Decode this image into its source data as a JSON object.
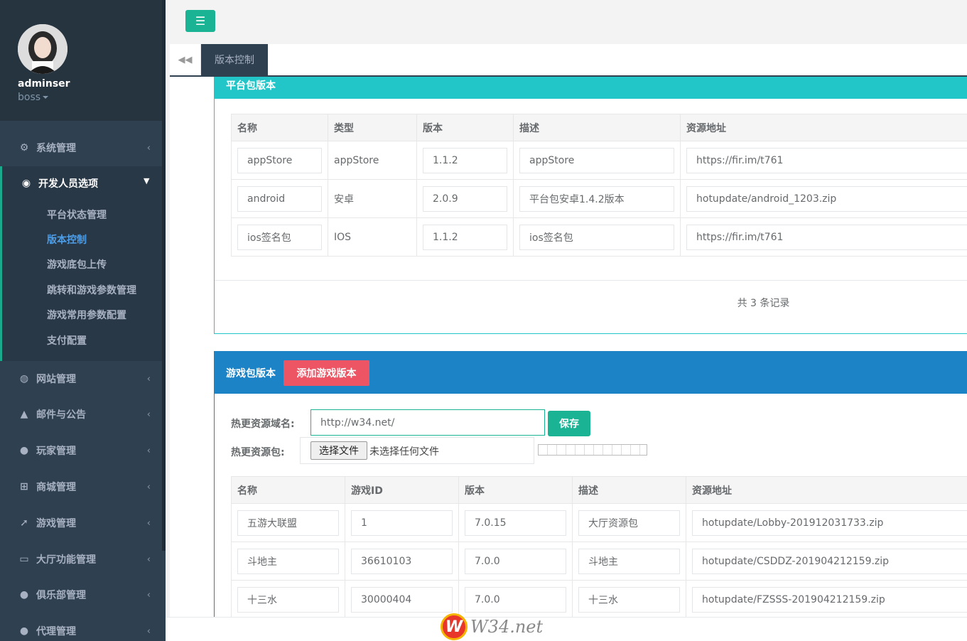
{
  "profile": {
    "name": "adminser",
    "role": "boss"
  },
  "sidebar": {
    "items": [
      {
        "icon": "gears-icon",
        "label": "系统管理"
      },
      {
        "icon": "globe-icon",
        "label": "网站管理"
      },
      {
        "icon": "bell-icon",
        "label": "邮件与公告"
      },
      {
        "icon": "user-icon",
        "label": "玩家管理"
      },
      {
        "icon": "cart-icon",
        "label": "商城管理"
      },
      {
        "icon": "rocket-icon",
        "label": "游戏管理"
      },
      {
        "icon": "desktop-icon",
        "label": "大厅功能管理"
      },
      {
        "icon": "users-icon",
        "label": "俱乐部管理"
      },
      {
        "icon": "user-secret-icon",
        "label": "代理管理"
      }
    ],
    "active_group": {
      "icon": "gamepad-icon",
      "label": "开发人员选项",
      "children": [
        "平台状态管理",
        "版本控制",
        "游戏底包上传",
        "跳转和游戏参数管理",
        "游戏常用参数配置",
        "支付配置"
      ],
      "active_child": "版本控制"
    }
  },
  "tabs": {
    "active_label": "版本控制"
  },
  "platform_panel": {
    "title": "平台包版本",
    "columns": [
      "名称",
      "类型",
      "版本",
      "描述",
      "资源地址"
    ],
    "rows": [
      {
        "name": "appStore",
        "type": "appStore",
        "version": "1.1.2",
        "desc": "appStore",
        "url": "https://fir.im/t761"
      },
      {
        "name": "android",
        "type": "安卓",
        "version": "2.0.9",
        "desc": "平台包安卓1.4.2版本",
        "url": "hotupdate/android_1203.zip"
      },
      {
        "name": "ios签名包",
        "type": "IOS",
        "version": "1.1.2",
        "desc": "ios签名包",
        "url": "https://fir.im/t761"
      }
    ],
    "record_count": "共 3 条记录"
  },
  "game_panel": {
    "title": "游戏包版本",
    "add_button": "添加游戏版本",
    "domain_label": "热更资源域名:",
    "domain_value": "http://w34.net/",
    "save_button": "保存",
    "package_label": "热更资源包:",
    "file_button": "选择文件",
    "file_status": "未选择任何文件",
    "columns": [
      "名称",
      "游戏ID",
      "版本",
      "描述",
      "资源地址"
    ],
    "rows": [
      {
        "name": "五游大联盟",
        "id": "1",
        "version": "7.0.15",
        "desc": "大厅资源包",
        "url": "hotupdate/Lobby-201912031733.zip"
      },
      {
        "name": "斗地主",
        "id": "36610103",
        "version": "7.0.0",
        "desc": "斗地主",
        "url": "hotupdate/CSDDZ-201904212159.zip"
      },
      {
        "name": "十三水",
        "id": "30000404",
        "version": "7.0.0",
        "desc": "十三水",
        "url": "hotupdate/FZSSS-201904212159.zip"
      }
    ]
  },
  "watermark": {
    "mark": "W",
    "text": "W34.net"
  },
  "colors": {
    "sidebar": "#2f4050",
    "primary": "#1ab394",
    "info": "#23c6c8",
    "success": "#1c84c6",
    "danger": "#ed5565"
  }
}
